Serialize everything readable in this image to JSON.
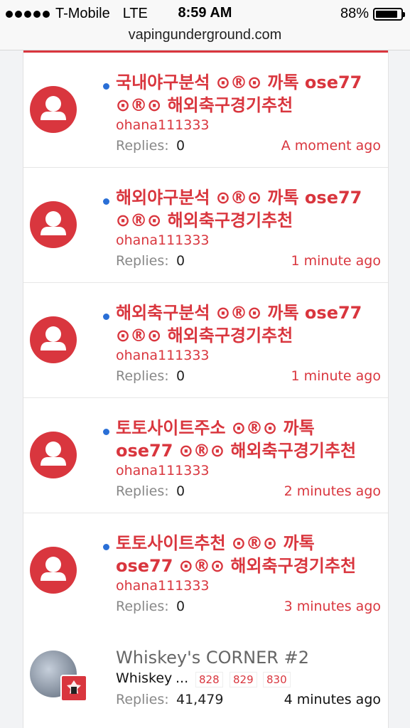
{
  "status_bar": {
    "carrier": "T-Mobile",
    "network": "LTE",
    "time": "8:59 AM",
    "battery_percent_label": "88%",
    "battery_level": 0.88
  },
  "browser": {
    "url": "vapingunderground.com"
  },
  "colors": {
    "accent": "#d9363e",
    "unread_dot": "#2a6fd6",
    "muted": "#888888"
  },
  "threads": [
    {
      "title_line1": "국내야구분석 ⊙®⊙ 까톡 ose77",
      "title_line2": "⊙®⊙ 해외축구경기추천",
      "author": "ohana111333",
      "replies_label": "Replies:",
      "replies": "0",
      "time": "A moment ago"
    },
    {
      "title_line1": "해외야구분석 ⊙®⊙ 까톡 ose77",
      "title_line2": "⊙®⊙ 해외축구경기추천",
      "author": "ohana111333",
      "replies_label": "Replies:",
      "replies": "0",
      "time": "1 minute ago"
    },
    {
      "title_line1": "해외축구분석 ⊙®⊙ 까톡 ose77",
      "title_line2": "⊙®⊙ 해외축구경기추천",
      "author": "ohana111333",
      "replies_label": "Replies:",
      "replies": "0",
      "time": "1 minute ago"
    },
    {
      "title_line1": "토토사이트주소 ⊙®⊙ 까톡",
      "title_line2": "ose77 ⊙®⊙ 해외축구경기추천",
      "author": "ohana111333",
      "replies_label": "Replies:",
      "replies": "0",
      "time": "2 minutes ago"
    },
    {
      "title_line1": "토토사이트추천 ⊙®⊙ 까톡",
      "title_line2": "ose77 ⊙®⊙ 해외축구경기추천",
      "author": "ohana111333",
      "replies_label": "Replies:",
      "replies": "0",
      "time": "3 minutes ago"
    }
  ],
  "whiskey_thread": {
    "title": "Whiskey's CORNER #2",
    "author": "Whiskey",
    "ellipsis": "...",
    "pages": [
      "828",
      "829",
      "830"
    ],
    "replies_label": "Replies:",
    "replies": "41,479",
    "time": "4 minutes ago"
  }
}
